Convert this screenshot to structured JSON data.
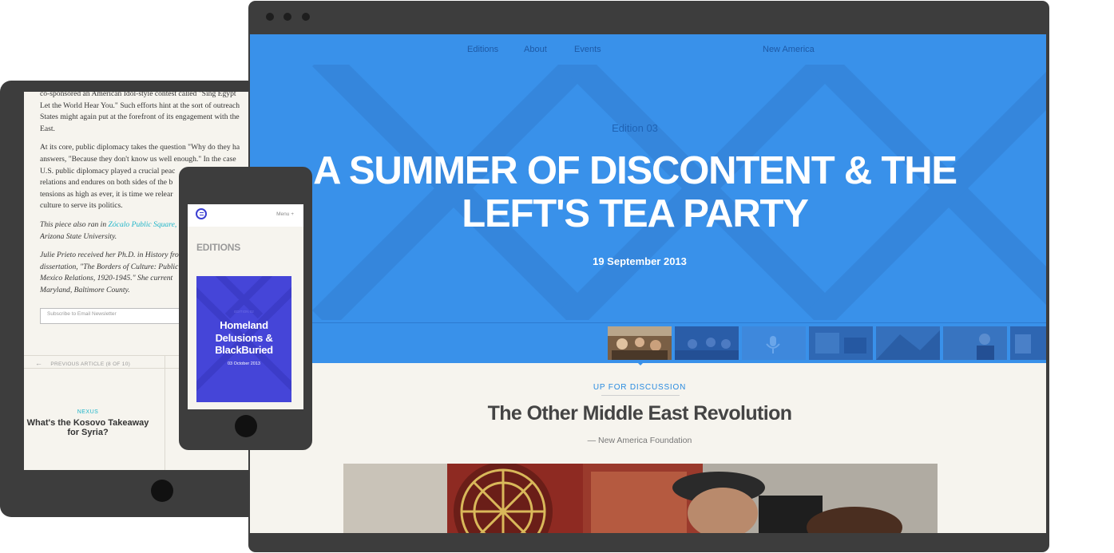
{
  "tablet": {
    "article_lines": [
      [
        "co-sponsored an American Idol-style contest called \"Sing Egypt",
        "Let the World Hear You.\" Such efforts hint at the sort of outreach",
        "States might again put at the forefront of its engagement with the",
        "East."
      ],
      [
        "At its core, public diplomacy takes the question \"Why do they ha",
        "answers, \"Because they don't know us well enough.\" In the case",
        "U.S. public diplomacy played a crucial peac",
        "relations and endures on both sides of the b",
        "tensions as high as ever, it is time we relear",
        "culture to serve its politics."
      ]
    ],
    "also_ran_prefix": "This piece also ran in ",
    "also_ran_link": "Zócalo Public Square,",
    "also_ran_suffix": "Arizona State University.",
    "bio_lines": [
      "Julie Prieto received her Ph.D. in History from",
      "dissertation, \"The Borders of Culture: Public",
      "Mexico Relations, 1920-1945.\" She current",
      "Maryland, Baltimore County."
    ],
    "newsletter_placeholder": "Subscribe to Email Newsletter",
    "prev_article": "PREVIOUS ARTICLE (8 OF 10)",
    "related_kicker": "NEXUS",
    "related_title": "What's the Kosovo Takeaway for Syria?"
  },
  "phone": {
    "menu": "Menu +",
    "section_title": "EDITIONS",
    "card": {
      "kicker": "EDITION 02",
      "title": "Homeland Delusions & BlackBuried",
      "date": "03 October 2013",
      "color": "#4545d8"
    }
  },
  "desktop": {
    "nav": [
      "Editions",
      "About",
      "Events"
    ],
    "nav_right": "New America",
    "edition": "Edition 03",
    "headline": "A SUMMER OF DISCONTENT & THE LEFT'S TEA PARTY",
    "date": "19 September 2013",
    "kicker": "UP FOR DISCUSSION",
    "article_title": "The Other Middle East Revolution",
    "byline": "— New America Foundation",
    "accent": "#3991ea",
    "link_color": "#1fb5c9"
  }
}
